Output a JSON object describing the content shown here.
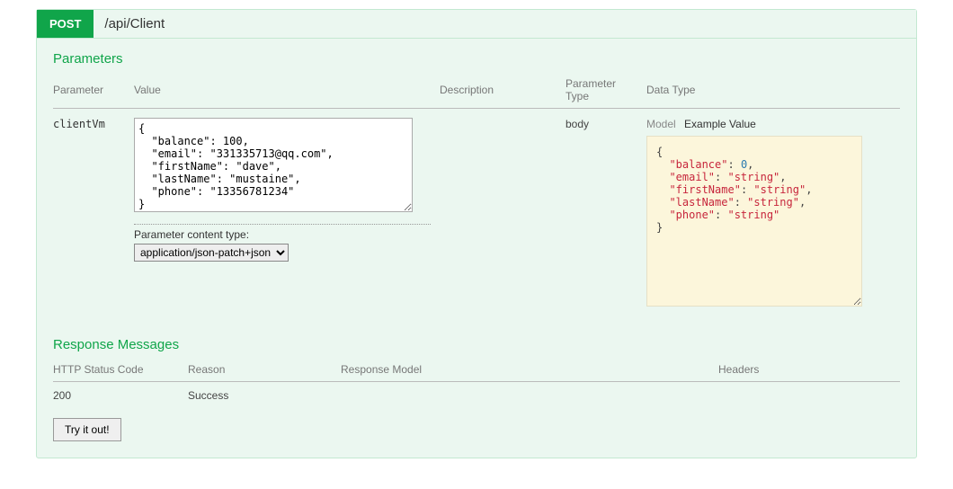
{
  "header": {
    "method": "POST",
    "path": "/api/Client"
  },
  "parameters": {
    "section_title": "Parameters",
    "columns": {
      "parameter": "Parameter",
      "value": "Value",
      "description": "Description",
      "parameter_type": "Parameter Type",
      "data_type": "Data Type"
    },
    "row": {
      "name": "clientVm",
      "value_text": "{\n  \"balance\": 100,\n  \"email\": \"331335713@qq.com\",\n  \"firstName\": \"dave\",\n  \"lastName\": \"mustaine\",\n  \"phone\": \"13356781234\"\n}",
      "content_type_label": "Parameter content type:",
      "content_type_value": "application/json-patch+json",
      "parameter_type": "body"
    },
    "datatype": {
      "model_label": "Model",
      "example_label": "Example Value",
      "example_lines": [
        {
          "text": "{"
        },
        {
          "key": "balance",
          "value": "0",
          "type": "num"
        },
        {
          "key": "email",
          "value": "\"string\"",
          "type": "str"
        },
        {
          "key": "firstName",
          "value": "\"string\"",
          "type": "str"
        },
        {
          "key": "lastName",
          "value": "\"string\"",
          "type": "str"
        },
        {
          "key": "phone",
          "value": "\"string\"",
          "type": "str"
        },
        {
          "text": "}"
        }
      ]
    }
  },
  "responses": {
    "section_title": "Response Messages",
    "columns": {
      "code": "HTTP Status Code",
      "reason": "Reason",
      "model": "Response Model",
      "headers": "Headers"
    },
    "rows": [
      {
        "code": "200",
        "reason": "Success",
        "model": "",
        "headers": ""
      }
    ]
  },
  "buttons": {
    "try": "Try it out!"
  }
}
